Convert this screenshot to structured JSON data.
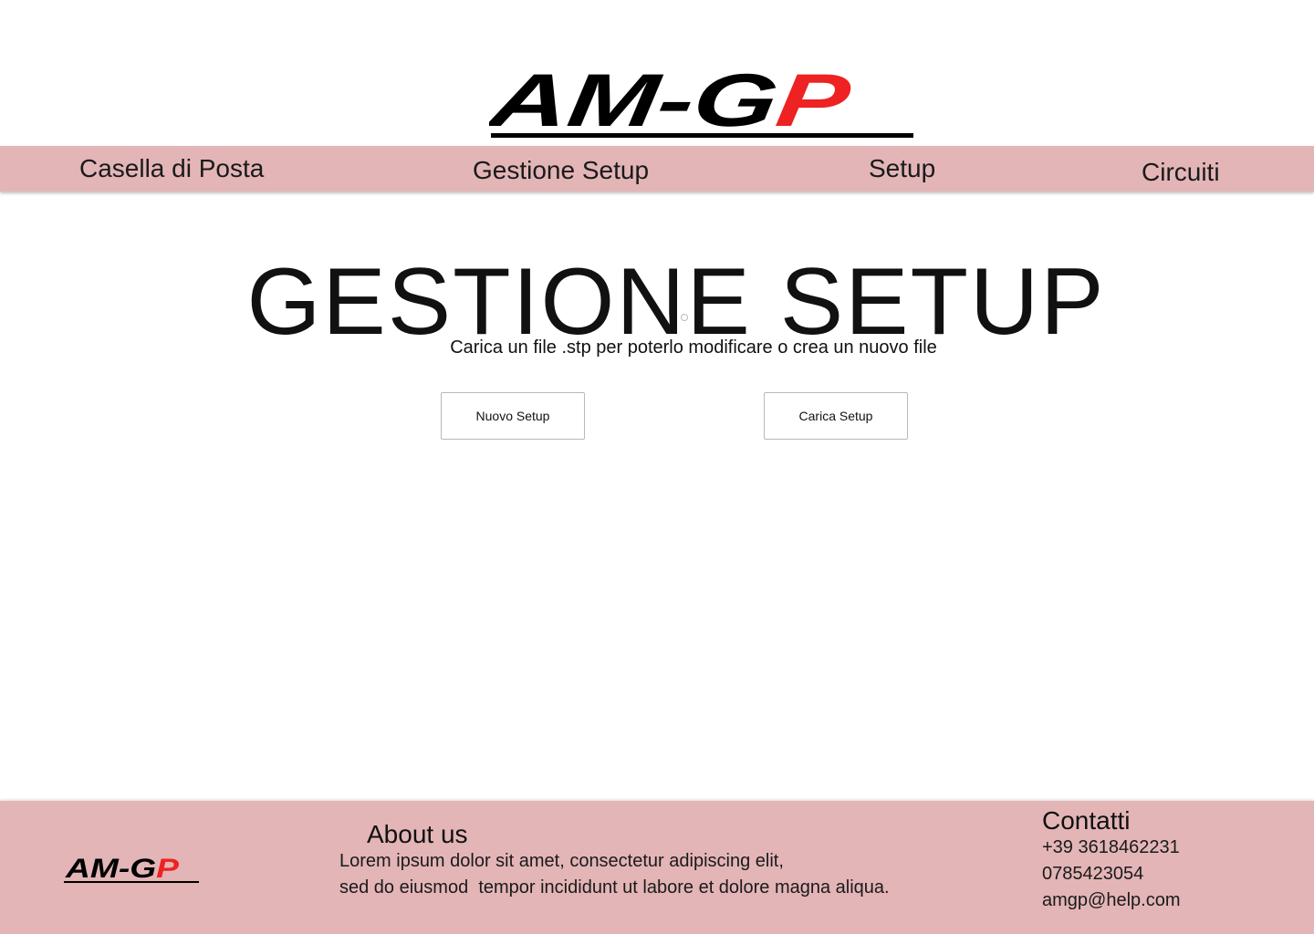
{
  "brand": {
    "logo_text_black": "AM-G",
    "logo_text_red": "P",
    "logo_red_color": "#ee2222",
    "logo_black_color": "#000000"
  },
  "nav": {
    "background": "#e3b5b7",
    "items": [
      {
        "label": "Casella di Posta"
      },
      {
        "label": "Gestione Setup"
      },
      {
        "label": "Setup"
      },
      {
        "label": "Circuiti"
      }
    ]
  },
  "main": {
    "title": "GESTIONE SETUP",
    "subtitle": "Carica un file .stp per poterlo modificare o crea un nuovo file",
    "new_setup_label": "Nuovo Setup",
    "load_setup_label": "Carica Setup"
  },
  "footer": {
    "background": "#e3b5b7",
    "about_title": "About us",
    "about_lines": [
      "Lorem ipsum dolor sit amet, consectetur adipiscing elit,",
      "sed do eiusmod  tempor incididunt ut labore et dolore magna aliqua."
    ],
    "contact_title": "Contatti",
    "contact_lines": [
      "+39 3618462231",
      "0785423054",
      "amgp@help.com"
    ]
  }
}
